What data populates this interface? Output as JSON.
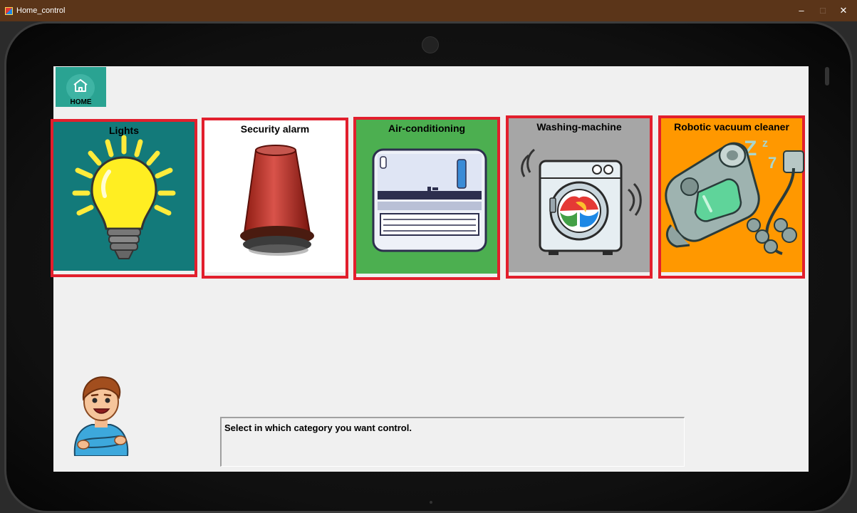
{
  "window": {
    "title": "Home_control",
    "controls": {
      "minimize": "–",
      "maximize": "□",
      "close": "✕"
    }
  },
  "home": {
    "label": "HOME",
    "icon": "home-icon"
  },
  "categories": [
    {
      "label": "Lights",
      "icon": "light-bulb-icon",
      "bg": "#137a7a"
    },
    {
      "label": "Security alarm",
      "icon": "alarm-siren-icon",
      "bg": "#ffffff"
    },
    {
      "label": "Air-conditioning",
      "icon": "air-conditioner-icon",
      "bg": "#4caf50"
    },
    {
      "label": "Washing-machine",
      "icon": "washing-machine-icon",
      "bg": "#a6a6a6"
    },
    {
      "label": "Robotic vacuum cleaner",
      "icon": "robot-vacuum-icon",
      "bg": "#ff9800"
    }
  ],
  "selection_border_color": "#e21f2d",
  "assistant": {
    "icon": "assistant-avatar-icon"
  },
  "status": {
    "message": "Select in which category you want control."
  }
}
